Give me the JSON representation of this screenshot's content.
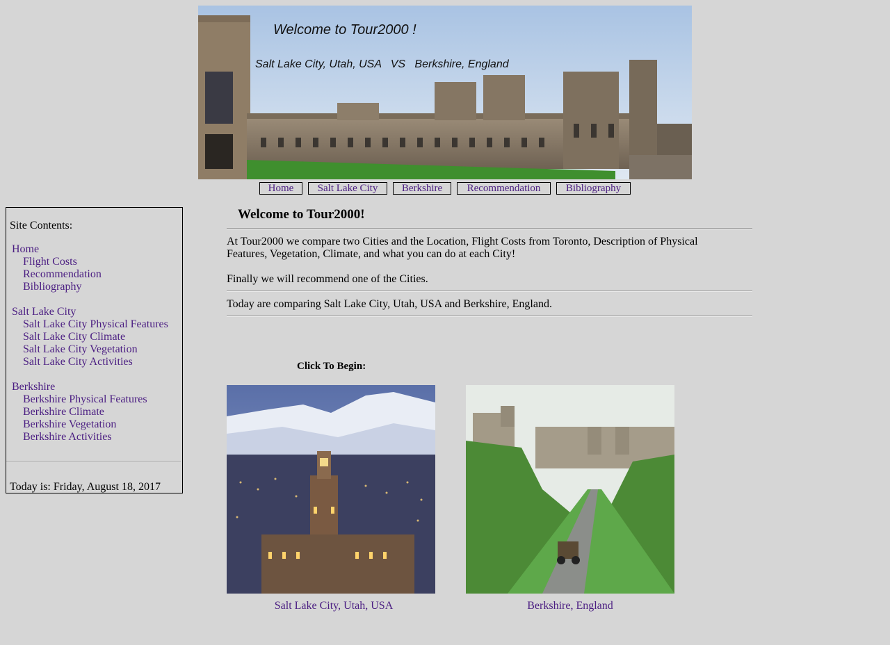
{
  "banner": {
    "title": "Welcome to Tour2000 !",
    "subtitle": "Salt Lake City, Utah, USA   VS   Berkshire, England"
  },
  "nav": [
    {
      "label": "Home"
    },
    {
      "label": "Salt Lake City"
    },
    {
      "label": "Berkshire"
    },
    {
      "label": "Recommendation"
    },
    {
      "label": "Bibliography"
    }
  ],
  "sidebar": {
    "heading": "Site Contents:",
    "home": "Home",
    "home_items": [
      "Flight Costs",
      "Recommendation",
      "Bibliography"
    ],
    "slc": "Salt Lake City",
    "slc_items": [
      "Salt Lake City Physical Features",
      "Salt Lake City Climate",
      "Salt Lake City Vegetation",
      "Salt Lake City Activities"
    ],
    "berk": "Berkshire",
    "berk_items": [
      "Berkshire Physical Features",
      "Berkshire Climate",
      "Berkshire Vegetation",
      "Berkshire Activities"
    ],
    "date": "Today is: Friday, August 18, 2017"
  },
  "main": {
    "title": "Welcome to Tour2000!",
    "intro": "At Tour2000 we compare two Cities and the Location, Flight Costs from Toronto, Description of Physical Features, Vegetation, Climate, and what you can do at each City!",
    "recommend": "Finally we will recommend one of the Cities.",
    "today": "Today are comparing Salt Lake City, Utah, USA and Berkshire, England.",
    "click_label": "Click To Begin:",
    "cities": [
      {
        "caption": "Salt Lake City, Utah, USA"
      },
      {
        "caption": "Berkshire, England"
      }
    ]
  },
  "colors": {
    "background": "#d6d6d6",
    "link": "#4b1e82"
  }
}
